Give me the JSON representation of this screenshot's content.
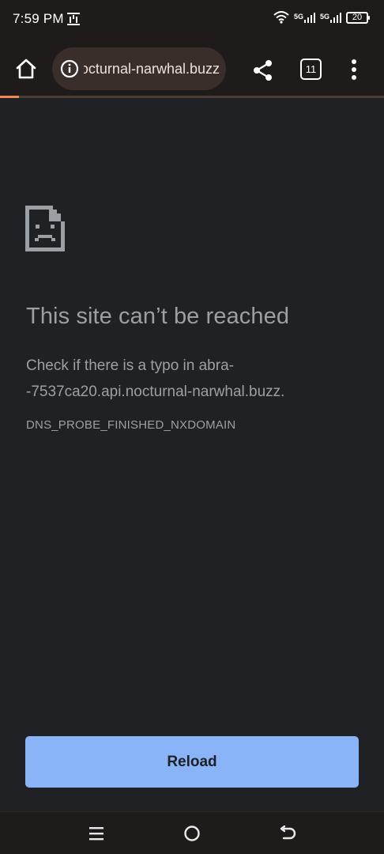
{
  "status_bar": {
    "time": "7:59 PM",
    "network_1": "5G",
    "network_2": "5G",
    "battery": "20"
  },
  "toolbar": {
    "url": "abra-7537ca20.api.nocturnal-narwhal.buzz",
    "tab_count": "11",
    "load_progress": 0.05
  },
  "error": {
    "title": "This site can’t be reached",
    "desc_line1": "Check if there is a typo in abra-",
    "desc_line2": "-7537ca20.api.nocturnal-narwhal.buzz.",
    "code": "DNS_PROBE_FINISHED_NXDOMAIN",
    "reload_label": "Reload"
  },
  "colors": {
    "background": "#202124",
    "toolbar": "#1f1b1a",
    "omnibox": "#3a2e2a",
    "accent": "#8ab4f8",
    "progress": "#f28b4c"
  },
  "icons": {
    "notification": "wireless-notif-icon",
    "wifi": "wifi-icon",
    "home": "home-icon",
    "info": "info-icon",
    "share": "share-icon",
    "menu": "more-vert-icon",
    "error": "sad-page-icon"
  }
}
